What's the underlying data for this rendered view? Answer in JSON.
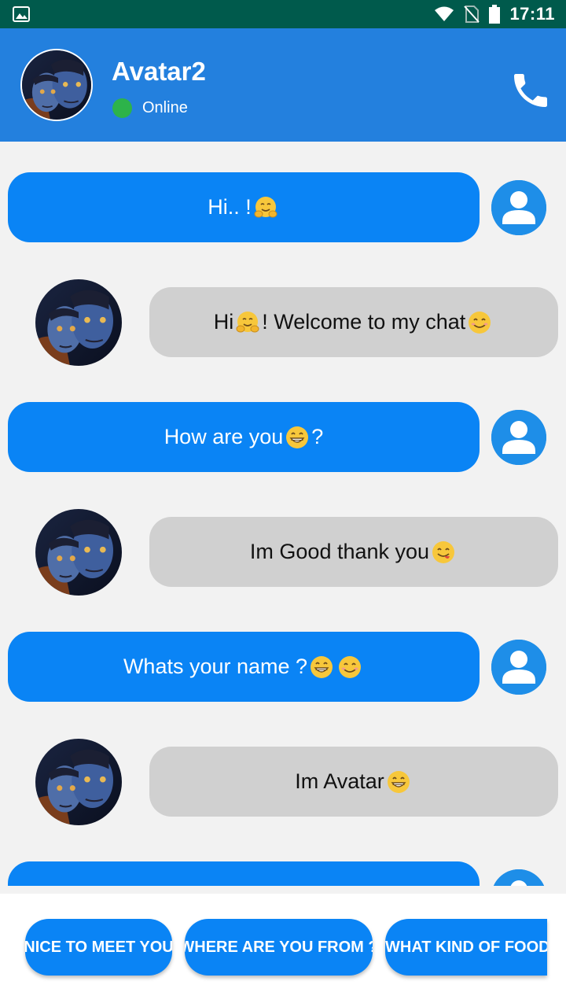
{
  "status_bar": {
    "time": "17:11"
  },
  "header": {
    "contact_name": "Avatar2",
    "status": "Online",
    "accent_color": "#2380de",
    "online_color": "#2db34a"
  },
  "messages": [
    {
      "sender": "user",
      "text": "Hi.. !",
      "emoji": [
        "hug"
      ]
    },
    {
      "sender": "bot",
      "text_before": "Hi",
      "text_after": "! Welcome to my chat",
      "emoji": [
        "hug",
        "smile"
      ]
    },
    {
      "sender": "user",
      "text_before": "How are you",
      "text_after": "?",
      "emoji": [
        "grin"
      ]
    },
    {
      "sender": "bot",
      "text": "Im Good thank you",
      "emoji": [
        "yum"
      ]
    },
    {
      "sender": "user",
      "text": "Whats your name ?",
      "emoji": [
        "grin",
        "smile"
      ]
    },
    {
      "sender": "bot",
      "text": "Im Avatar",
      "emoji": [
        "grin"
      ]
    }
  ],
  "quick_replies": [
    "NICE TO MEET YOU",
    "WHERE ARE YOU FROM ?",
    "WHAT KIND OF FOOD"
  ],
  "colors": {
    "user_bubble": "#0a84f5",
    "bot_bubble": "#d0d0d0",
    "background": "#f2f2f2"
  }
}
